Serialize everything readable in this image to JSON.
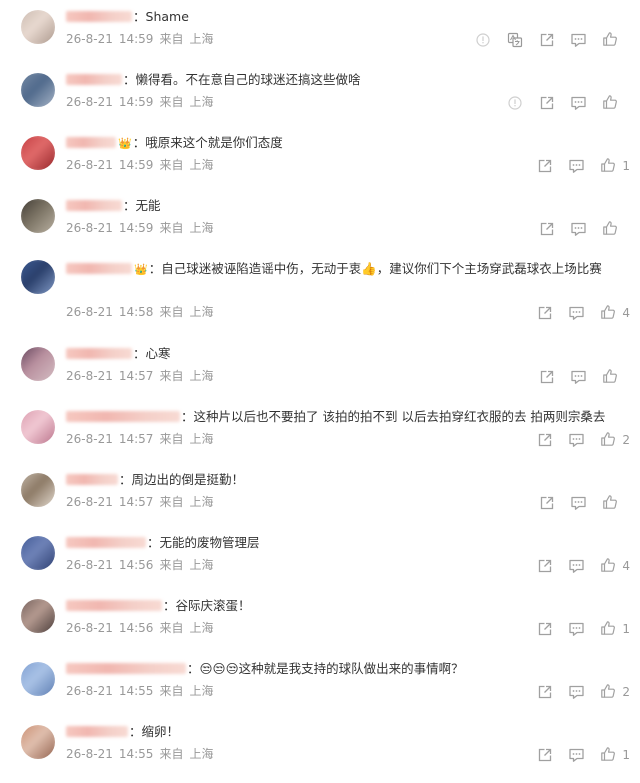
{
  "comments": [
    {
      "text": "Shame",
      "date": "26-8-21",
      "time": "14:59",
      "location_label": "来自",
      "location": "上海",
      "likes": "",
      "badge": "",
      "actions": [
        "report-icon",
        "translate-icon",
        "share-icon",
        "reply-icon",
        "like-icon"
      ]
    },
    {
      "text": "懒得看。不在意自己的球迷还搞这些做啥",
      "date": "26-8-21",
      "time": "14:59",
      "location_label": "来自",
      "location": "上海",
      "likes": "",
      "badge": "",
      "actions": [
        "report-icon",
        "share-icon",
        "reply-icon",
        "like-icon"
      ]
    },
    {
      "text": "哦原来这个就是你们态度",
      "date": "26-8-21",
      "time": "14:59",
      "location_label": "来自",
      "location": "上海",
      "likes": "1",
      "badge": "crown",
      "actions": [
        "share-icon",
        "reply-icon",
        "like-icon"
      ]
    },
    {
      "text": "无能",
      "date": "26-8-21",
      "time": "14:59",
      "location_label": "来自",
      "location": "上海",
      "likes": "",
      "badge": "",
      "actions": [
        "share-icon",
        "reply-icon",
        "like-icon"
      ]
    },
    {
      "text": "自己球迷被诬陷造谣中伤，无动于衷👍，建议你们下个主场穿武磊球衣上场比赛",
      "date": "26-8-21",
      "time": "14:58",
      "location_label": "来自",
      "location": "上海",
      "likes": "4",
      "badge": "crown",
      "actions": [
        "share-icon",
        "reply-icon",
        "like-icon"
      ]
    },
    {
      "text": "心寒",
      "date": "26-8-21",
      "time": "14:57",
      "location_label": "来自",
      "location": "上海",
      "likes": "",
      "badge": "",
      "actions": [
        "share-icon",
        "reply-icon",
        "like-icon"
      ]
    },
    {
      "text": "这种片以后也不要拍了 该拍的拍不到 以后去拍穿红衣服的去 拍两则宗桑去",
      "date": "26-8-21",
      "time": "14:57",
      "location_label": "来自",
      "location": "上海",
      "likes": "2",
      "badge": "",
      "actions": [
        "share-icon",
        "reply-icon",
        "like-icon"
      ]
    },
    {
      "text": "周边出的倒是挺勤！",
      "date": "26-8-21",
      "time": "14:57",
      "location_label": "来自",
      "location": "上海",
      "likes": "",
      "badge": "",
      "actions": [
        "share-icon",
        "reply-icon",
        "like-icon"
      ]
    },
    {
      "text": "无能的废物管理层",
      "date": "26-8-21",
      "time": "14:56",
      "location_label": "来自",
      "location": "上海",
      "likes": "4",
      "badge": "",
      "actions": [
        "share-icon",
        "reply-icon",
        "like-icon"
      ]
    },
    {
      "text": "谷际庆滚蛋！",
      "date": "26-8-21",
      "time": "14:56",
      "location_label": "来自",
      "location": "上海",
      "likes": "1",
      "badge": "",
      "actions": [
        "share-icon",
        "reply-icon",
        "like-icon"
      ]
    },
    {
      "text": "😒😒😒这种就是我支持的球队做出来的事情啊？",
      "date": "26-8-21",
      "time": "14:55",
      "location_label": "来自",
      "location": "上海",
      "likes": "2",
      "badge": "",
      "actions": [
        "share-icon",
        "reply-icon",
        "like-icon"
      ]
    },
    {
      "text": "缩卵！",
      "date": "26-8-21",
      "time": "14:55",
      "location_label": "来自",
      "location": "上海",
      "likes": "1",
      "badge": "",
      "actions": [
        "share-icon",
        "reply-icon",
        "like-icon"
      ]
    }
  ],
  "colors": {
    "text": "#333333",
    "meta": "#999999",
    "icon": "#a0a0a0"
  }
}
